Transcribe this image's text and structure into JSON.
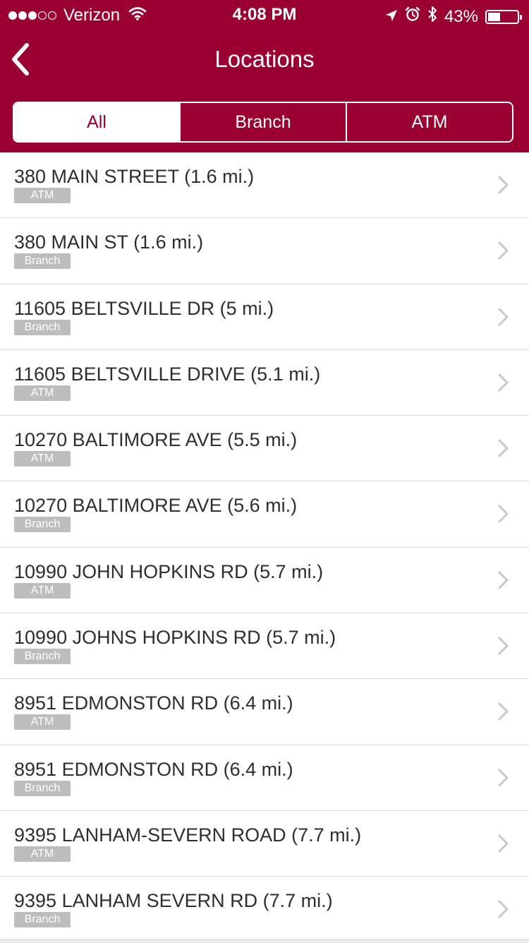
{
  "colors": {
    "brand": "#9b0033",
    "text": "#2b2f33",
    "badge": "#bdbdbd",
    "divider": "#d6d6d6"
  },
  "status_bar": {
    "carrier": "Verizon",
    "time": "4:08 PM",
    "battery_percent": "43%",
    "battery_level": 0.43,
    "signal_bars_filled": 3,
    "signal_bars_total": 5,
    "icons": [
      "wifi-icon",
      "location-arrow-icon",
      "alarm-icon",
      "bluetooth-icon",
      "battery-icon"
    ]
  },
  "nav": {
    "title": "Locations",
    "back_icon": "chevron-left-icon"
  },
  "segments": [
    {
      "label": "All",
      "selected": true
    },
    {
      "label": "Branch",
      "selected": false
    },
    {
      "label": "ATM",
      "selected": false
    }
  ],
  "locations": [
    {
      "address": "380 MAIN STREET (1.6 mi.)",
      "type": "ATM"
    },
    {
      "address": "380 MAIN ST (1.6 mi.)",
      "type": "Branch"
    },
    {
      "address": "11605 BELTSVILLE DR (5 mi.)",
      "type": "Branch"
    },
    {
      "address": "11605 BELTSVILLE DRIVE (5.1 mi.)",
      "type": "ATM"
    },
    {
      "address": "10270 BALTIMORE AVE (5.5 mi.)",
      "type": "ATM"
    },
    {
      "address": "10270 BALTIMORE AVE (5.6 mi.)",
      "type": "Branch"
    },
    {
      "address": "10990 JOHN HOPKINS RD (5.7 mi.)",
      "type": "ATM"
    },
    {
      "address": "10990 JOHNS HOPKINS RD (5.7 mi.)",
      "type": "Branch"
    },
    {
      "address": "8951 EDMONSTON RD (6.4 mi.)",
      "type": "ATM"
    },
    {
      "address": "8951 EDMONSTON RD (6.4 mi.)",
      "type": "Branch"
    },
    {
      "address": "9395 LANHAM-SEVERN ROAD (7.7 mi.)",
      "type": "ATM"
    },
    {
      "address": "9395 LANHAM SEVERN RD (7.7 mi.)",
      "type": "Branch"
    }
  ]
}
